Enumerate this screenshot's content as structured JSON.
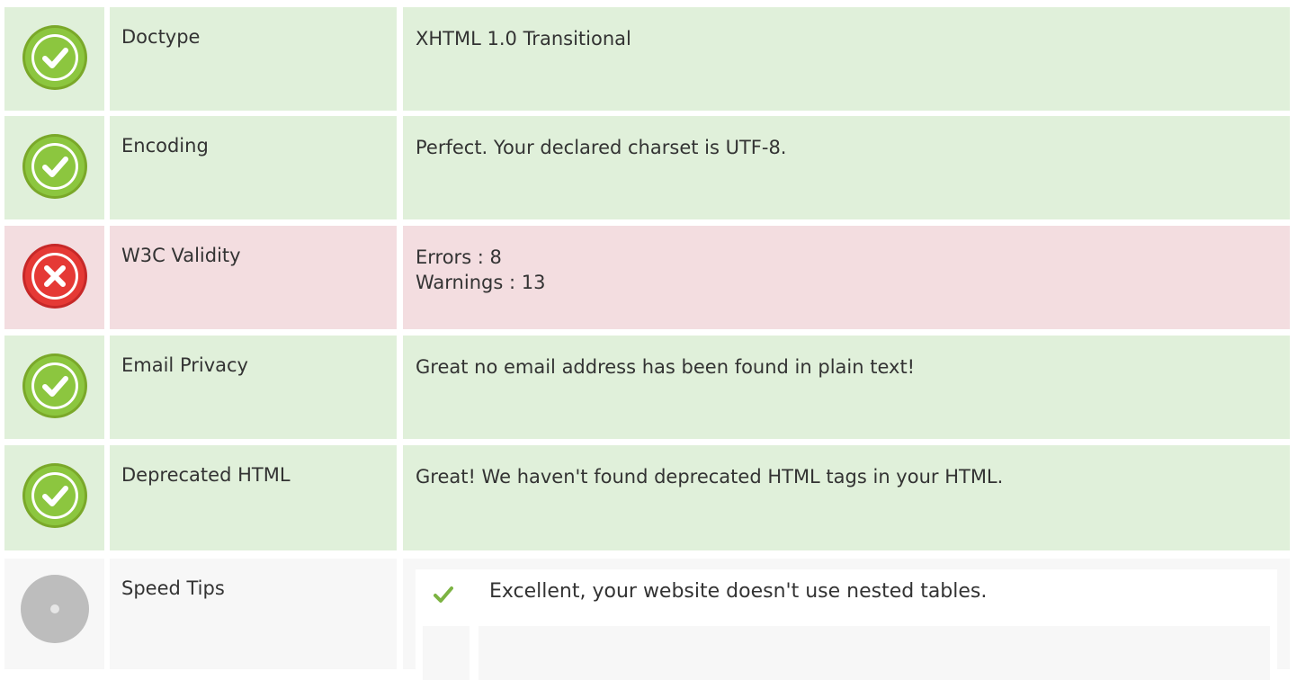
{
  "rows": [
    {
      "label": "Doctype",
      "value_lines": [
        "XHTML 1.0 Transitional"
      ],
      "status": "pass"
    },
    {
      "label": "Encoding",
      "value_lines": [
        "Perfect. Your declared charset is UTF-8."
      ],
      "status": "pass"
    },
    {
      "label": "W3C Validity",
      "value_lines": [
        "Errors : 8",
        "Warnings : 13"
      ],
      "status": "fail"
    },
    {
      "label": "Email Privacy",
      "value_lines": [
        "Great no email address has been found in plain text!"
      ],
      "status": "pass"
    },
    {
      "label": "Deprecated HTML",
      "value_lines": [
        "Great! We haven't found deprecated HTML tags in your HTML."
      ],
      "status": "pass"
    }
  ],
  "speed_tips": {
    "label": "Speed Tips",
    "status": "neutral",
    "tips": [
      {
        "text": "Excellent, your website doesn't use nested tables.",
        "icon": "check-icon"
      }
    ]
  },
  "colors": {
    "pass_bg": "#e0f0da",
    "fail_bg": "#f3dde0",
    "neutral_bg": "#f7f7f7",
    "pass_icon": "#8cc63f",
    "fail_icon": "#e53935",
    "neutral_icon": "#bdbdbd"
  },
  "icons": {
    "pass": "check-circle-icon",
    "fail": "x-circle-icon",
    "neutral": "dot-circle-icon"
  }
}
